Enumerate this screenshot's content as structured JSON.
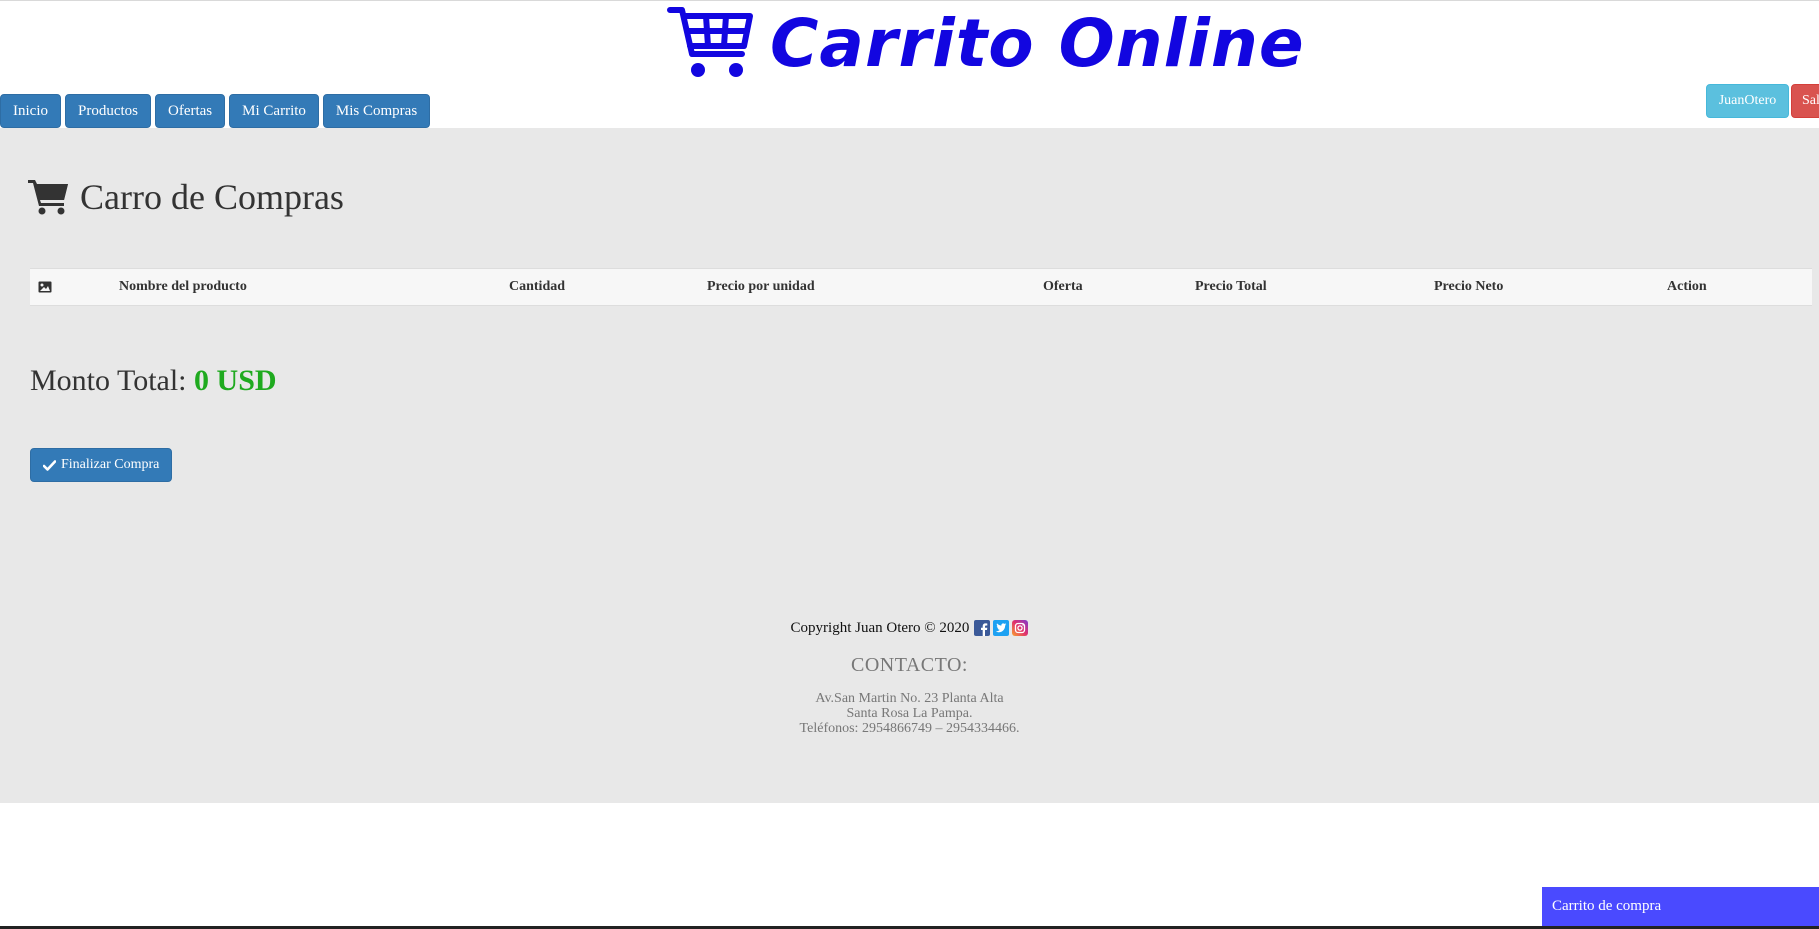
{
  "header": {
    "logo_text": "Carrito Online",
    "logo_color": "#1206e0"
  },
  "nav": {
    "items": [
      {
        "label": "Inicio"
      },
      {
        "label": "Productos"
      },
      {
        "label": "Ofertas"
      },
      {
        "label": "Mi Carrito"
      },
      {
        "label": "Mis Compras"
      }
    ]
  },
  "user": {
    "name": "JuanOtero",
    "logout_label": "Sal"
  },
  "cart": {
    "title": "Carro de Compras",
    "title_icon": "shopping-cart-icon",
    "columns": {
      "image_icon": "image-icon",
      "name": "Nombre del producto",
      "quantity": "Cantidad",
      "unit_price": "Precio por unidad",
      "offer": "Oferta",
      "total_price": "Precio Total",
      "net_price": "Precio Neto",
      "action": "Action"
    },
    "rows": [],
    "total_label": "Monto Total:",
    "total_value": "0 USD",
    "checkout_label": "Finalizar Compra",
    "checkout_icon": "check-icon"
  },
  "footer": {
    "copyright": "Copyright Juan Otero © 2020",
    "social_icons": [
      "facebook-icon",
      "twitter-icon",
      "instagram-icon"
    ],
    "contact_title": "CONTACTO:",
    "address_line1": "Av.San Martin No. 23 Planta Alta",
    "address_line2": "Santa Rosa La Pampa.",
    "phones": "Teléfonos: 2954866749 – 2954334466."
  },
  "floating_cart": {
    "label": "Carrito de compra"
  },
  "colors": {
    "primary_button": "#337ab7",
    "info_button": "#5bc0de",
    "danger_button": "#d9534f",
    "total_green": "#1faa1f",
    "floating_tab": "#4a4aff",
    "main_background": "#e8e8e8"
  }
}
